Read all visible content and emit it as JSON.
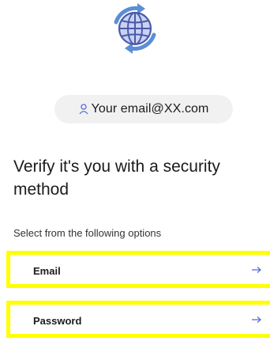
{
  "logo": {
    "icon": "globe-sync-icon",
    "colors": {
      "ring": "#5b8ed6",
      "fill": "#c8d3f4",
      "lines": "#4b5aa8"
    }
  },
  "identity": {
    "icon": "user-icon",
    "email": "Your email@XX.com"
  },
  "title": "Verify it's you with a security method",
  "subtitle": "Select from the following options",
  "options": [
    {
      "label": "Email",
      "icon": "arrow-right-icon"
    },
    {
      "label": "Password",
      "icon": "arrow-right-icon"
    }
  ],
  "highlight_color": "#ffff00"
}
